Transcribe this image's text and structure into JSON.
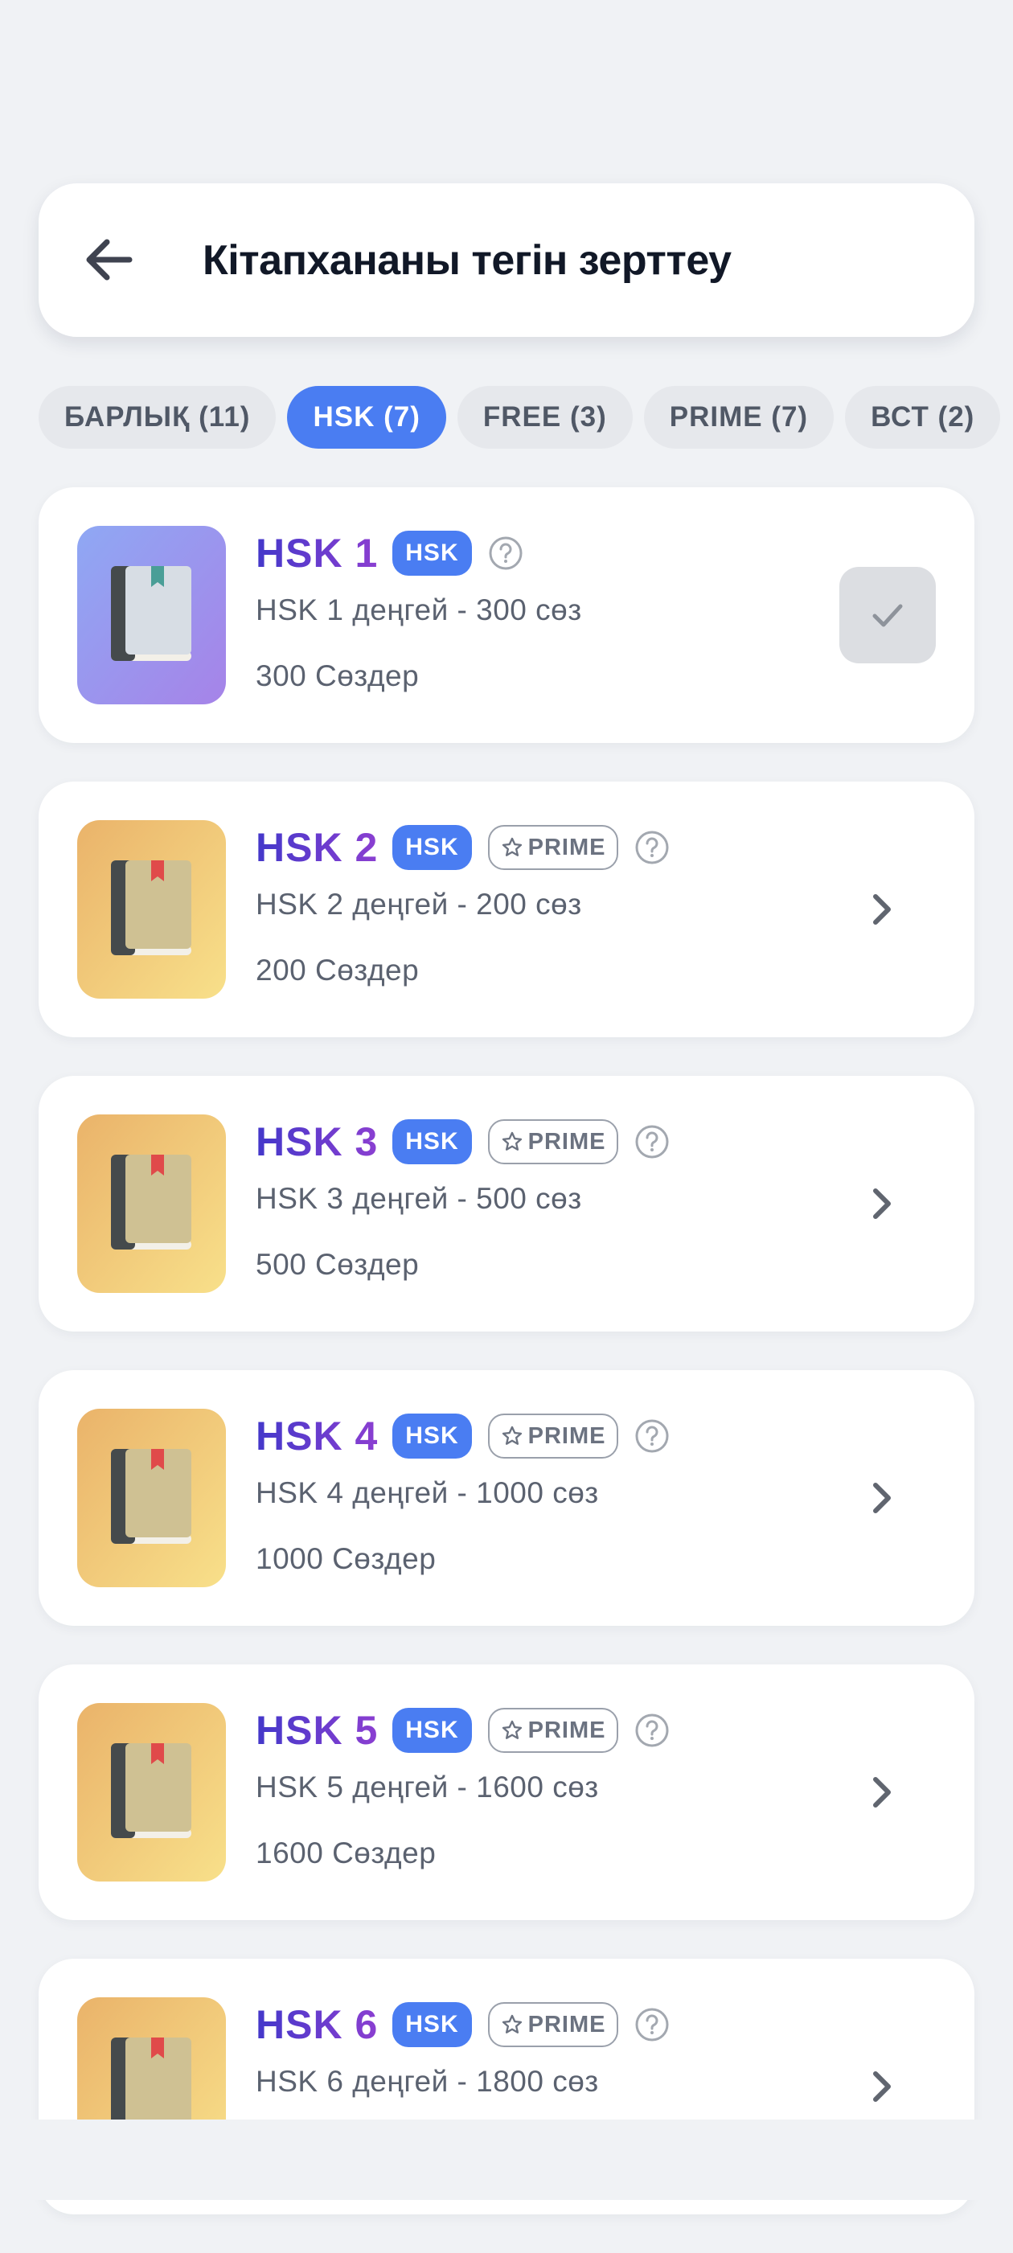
{
  "header": {
    "back_icon": "arrow-left-icon",
    "title": "Кітапхананы тегін зерттеу"
  },
  "tabs": [
    {
      "label": "БАРЛЫҚ (11)",
      "active": false
    },
    {
      "label": "HSK (7)",
      "active": true
    },
    {
      "label": "FREE (3)",
      "active": false
    },
    {
      "label": "PRIME (7)",
      "active": false
    },
    {
      "label": "ВСТ (2)",
      "active": false
    }
  ],
  "colors": {
    "accent": "#4a7df2",
    "title_gradient_start": "#4338ca",
    "title_gradient_end": "#8b3fd1",
    "background": "#f0f2f5"
  },
  "cards": [
    {
      "title": "HSK 1",
      "badge": "HSK",
      "prime_label": "",
      "description": "HSK 1 деңгей - 300 сөз",
      "count": "300 Сөздер",
      "icon": "book-icon",
      "icon_theme": "purple",
      "action": "check"
    },
    {
      "title": "HSK 2",
      "badge": "HSK",
      "prime_label": "PRIME",
      "description": "HSK 2 деңгей - 200 сөз",
      "count": "200 Сөздер",
      "icon": "book-icon",
      "icon_theme": "gold",
      "action": "chevron"
    },
    {
      "title": "HSK 3",
      "badge": "HSK",
      "prime_label": "PRIME",
      "description": "HSK 3 деңгей - 500 сөз",
      "count": "500 Сөздер",
      "icon": "book-icon",
      "icon_theme": "gold",
      "action": "chevron"
    },
    {
      "title": "HSK 4",
      "badge": "HSK",
      "prime_label": "PRIME",
      "description": "HSK 4 деңгей - 1000 сөз",
      "count": "1000 Сөздер",
      "icon": "book-icon",
      "icon_theme": "gold",
      "action": "chevron"
    },
    {
      "title": "HSK 5",
      "badge": "HSK",
      "prime_label": "PRIME",
      "description": "HSK 5 деңгей - 1600 сөз",
      "count": "1600 Сөздер",
      "icon": "book-icon",
      "icon_theme": "gold",
      "action": "chevron"
    },
    {
      "title": "HSK 6",
      "badge": "HSK",
      "prime_label": "PRIME",
      "description": "HSK 6 деңгей - 1800 сөз",
      "count": "",
      "icon": "book-icon",
      "icon_theme": "gold",
      "action": "chevron"
    }
  ]
}
